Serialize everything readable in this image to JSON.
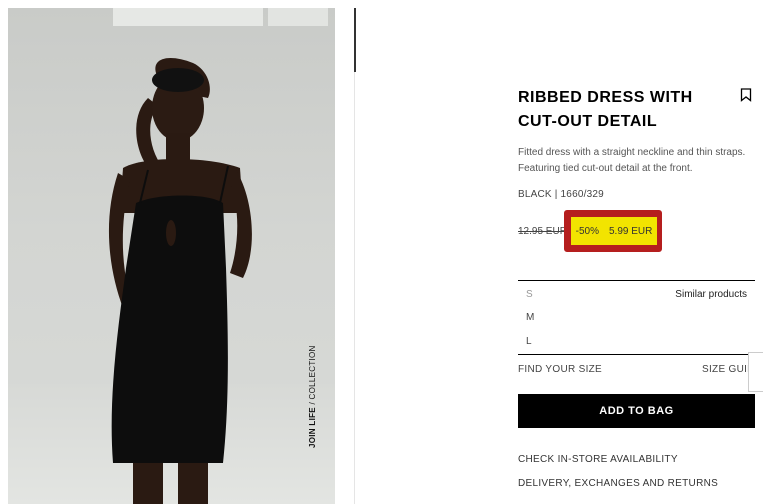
{
  "product": {
    "title": "RIBBED DRESS WITH CUT-OUT DETAIL",
    "description": "Fitted dress with a straight neckline and thin straps. Featuring tied cut-out detail at the front.",
    "color_ref": "BLACK | 1660/329",
    "old_price": "12.95 EUR",
    "discount": "-50%",
    "price": "5.99 EUR"
  },
  "image": {
    "vertical_caption_bold": "JOIN LIFE",
    "vertical_caption_rest": " / COLLECTION"
  },
  "sizes": [
    "S",
    "M",
    "L"
  ],
  "similar_products": "Similar products",
  "find_your_size": "FIND YOUR SIZE",
  "size_guide": "SIZE GUIDE",
  "add_to_bag": "ADD TO BAG",
  "links": {
    "store_availability": "CHECK IN-STORE AVAILABILITY",
    "delivery": "DELIVERY, EXCHANGES AND RETURNS"
  },
  "icons": {
    "bookmark": "bookmark-icon"
  },
  "colors": {
    "promo_bg": "#f2e400",
    "highlight_border": "#b51e1e",
    "button_bg": "#000000"
  }
}
